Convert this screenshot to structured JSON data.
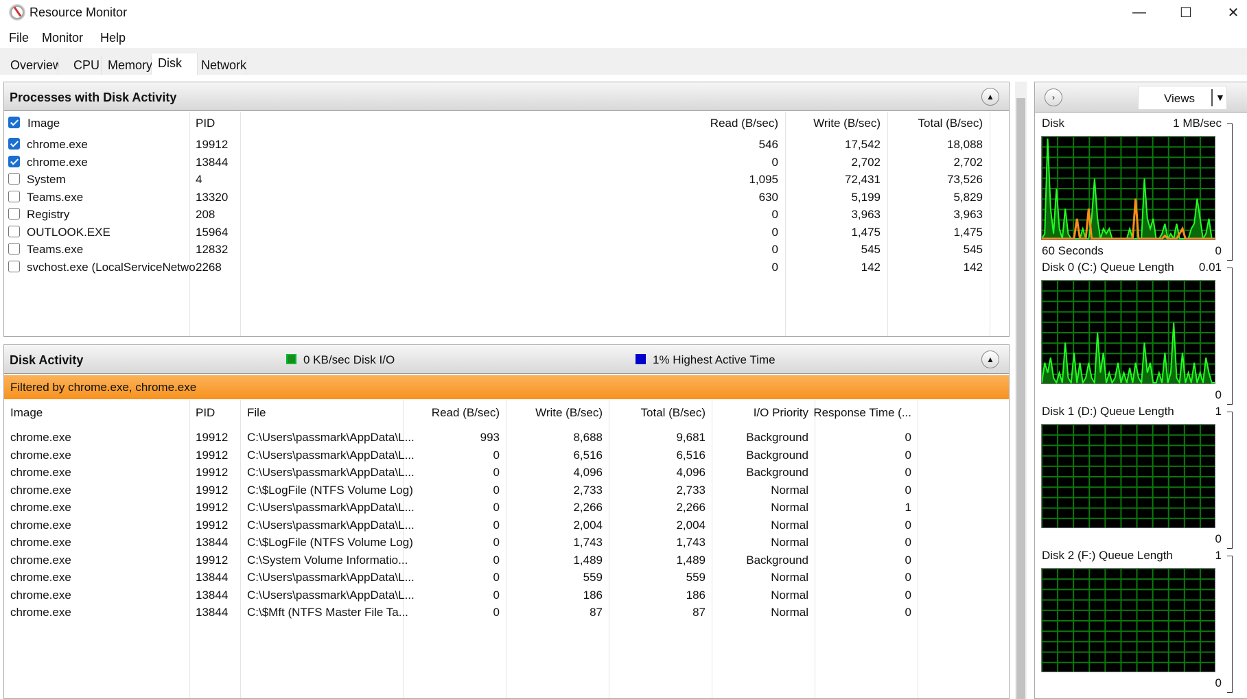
{
  "window": {
    "title": "Resource Monitor",
    "minimize": "—",
    "maximize": "☐",
    "close": "✕"
  },
  "menu": [
    "File",
    "Monitor",
    "Help"
  ],
  "tabs": [
    {
      "label": "Overview"
    },
    {
      "label": "CPU"
    },
    {
      "label": "Memory"
    },
    {
      "label": "Disk",
      "active": true
    },
    {
      "label": "Network"
    }
  ],
  "processes": {
    "title": "Processes with Disk Activity",
    "columns": [
      "Image",
      "PID",
      "Read (B/sec)",
      "Write (B/sec)",
      "Total (B/sec)"
    ],
    "rows": [
      {
        "checked": true,
        "image": "chrome.exe",
        "pid": "19912",
        "read": "546",
        "write": "17,542",
        "total": "18,088"
      },
      {
        "checked": true,
        "image": "chrome.exe",
        "pid": "13844",
        "read": "0",
        "write": "2,702",
        "total": "2,702"
      },
      {
        "checked": false,
        "image": "System",
        "pid": "4",
        "read": "1,095",
        "write": "72,431",
        "total": "73,526"
      },
      {
        "checked": false,
        "image": "Teams.exe",
        "pid": "13320",
        "read": "630",
        "write": "5,199",
        "total": "5,829"
      },
      {
        "checked": false,
        "image": "Registry",
        "pid": "208",
        "read": "0",
        "write": "3,963",
        "total": "3,963"
      },
      {
        "checked": false,
        "image": "OUTLOOK.EXE",
        "pid": "15964",
        "read": "0",
        "write": "1,475",
        "total": "1,475"
      },
      {
        "checked": false,
        "image": "Teams.exe",
        "pid": "12832",
        "read": "0",
        "write": "545",
        "total": "545"
      },
      {
        "checked": false,
        "image": "svchost.exe (LocalServiceNetwo...",
        "pid": "2268",
        "read": "0",
        "write": "142",
        "total": "142"
      }
    ]
  },
  "disk_activity": {
    "title": "Disk Activity",
    "io_label": "0 KB/sec Disk I/O",
    "active_label": "1% Highest Active Time",
    "io_color": "#1a8a1a",
    "active_color": "#0000cc",
    "filter": "Filtered by chrome.exe, chrome.exe",
    "filter_color": "#f7921e",
    "columns": [
      "Image",
      "PID",
      "File",
      "Read (B/sec)",
      "Write (B/sec)",
      "Total (B/sec)",
      "I/O Priority",
      "Response Time (..."
    ],
    "rows": [
      [
        "chrome.exe",
        "19912",
        "C:\\Users\\passmark\\AppData\\L...",
        "993",
        "8,688",
        "9,681",
        "Background",
        "0"
      ],
      [
        "chrome.exe",
        "19912",
        "C:\\Users\\passmark\\AppData\\L...",
        "0",
        "6,516",
        "6,516",
        "Background",
        "0"
      ],
      [
        "chrome.exe",
        "19912",
        "C:\\Users\\passmark\\AppData\\L...",
        "0",
        "4,096",
        "4,096",
        "Background",
        "0"
      ],
      [
        "chrome.exe",
        "19912",
        "C:\\$LogFile (NTFS Volume Log)",
        "0",
        "2,733",
        "2,733",
        "Normal",
        "0"
      ],
      [
        "chrome.exe",
        "19912",
        "C:\\Users\\passmark\\AppData\\L...",
        "0",
        "2,266",
        "2,266",
        "Normal",
        "1"
      ],
      [
        "chrome.exe",
        "19912",
        "C:\\Users\\passmark\\AppData\\L...",
        "0",
        "2,004",
        "2,004",
        "Normal",
        "0"
      ],
      [
        "chrome.exe",
        "13844",
        "C:\\$LogFile (NTFS Volume Log)",
        "0",
        "1,743",
        "1,743",
        "Normal",
        "0"
      ],
      [
        "chrome.exe",
        "19912",
        "C:\\System Volume Informatio...",
        "0",
        "1,489",
        "1,489",
        "Background",
        "0"
      ],
      [
        "chrome.exe",
        "13844",
        "C:\\Users\\passmark\\AppData\\L...",
        "0",
        "559",
        "559",
        "Normal",
        "0"
      ],
      [
        "chrome.exe",
        "13844",
        "C:\\Users\\passmark\\AppData\\L...",
        "0",
        "186",
        "186",
        "Normal",
        "0"
      ],
      [
        "chrome.exe",
        "13844",
        "C:\\$Mft (NTFS Master File Ta...",
        "0",
        "87",
        "87",
        "Normal",
        "0"
      ]
    ]
  },
  "side": {
    "views_label": "Views",
    "graphs": [
      {
        "title": "Disk",
        "max": "1 MB/sec",
        "min": "0",
        "footer": "60 Seconds",
        "green": [
          0,
          5,
          100,
          30,
          5,
          50,
          10,
          0,
          30,
          5,
          0,
          0,
          0,
          0,
          10,
          0,
          0,
          20,
          60,
          20,
          0,
          10,
          5,
          10,
          0,
          0,
          0,
          0,
          0,
          0,
          10,
          0,
          0,
          0,
          0,
          60,
          20,
          10,
          20,
          0,
          0,
          5,
          15,
          0,
          5,
          0,
          15,
          0,
          0,
          0,
          0,
          10,
          15,
          40,
          20,
          0,
          5,
          20,
          0,
          0
        ],
        "orange": [
          0,
          0,
          0,
          0,
          0,
          0,
          0,
          0,
          0,
          0,
          0,
          0,
          20,
          0,
          0,
          0,
          30,
          0,
          0,
          0,
          0,
          0,
          0,
          0,
          0,
          0,
          0,
          0,
          0,
          0,
          0,
          0,
          40,
          0,
          0,
          0,
          0,
          0,
          0,
          0,
          0,
          0,
          3,
          0,
          0,
          0,
          0,
          5,
          10,
          0,
          0,
          0,
          0,
          0,
          0,
          0,
          0,
          0,
          0,
          0
        ]
      },
      {
        "title": "Disk 0 (C:) Queue Length",
        "max": "0.01",
        "min": "0",
        "green": [
          0,
          20,
          10,
          25,
          5,
          0,
          10,
          0,
          40,
          5,
          0,
          30,
          0,
          20,
          0,
          5,
          20,
          5,
          0,
          50,
          10,
          30,
          0,
          10,
          0,
          5,
          20,
          0,
          10,
          0,
          15,
          0,
          20,
          5,
          0,
          40,
          10,
          20,
          0,
          0,
          10,
          0,
          30,
          0,
          10,
          60,
          5,
          0,
          30,
          0,
          10,
          0,
          20,
          0,
          10,
          0,
          25,
          10,
          0,
          0
        ]
      },
      {
        "title": "Disk 1 (D:) Queue Length",
        "max": "1",
        "min": "0",
        "green": []
      },
      {
        "title": "Disk 2 (F:) Queue Length",
        "max": "1",
        "min": "0",
        "green": []
      }
    ]
  }
}
